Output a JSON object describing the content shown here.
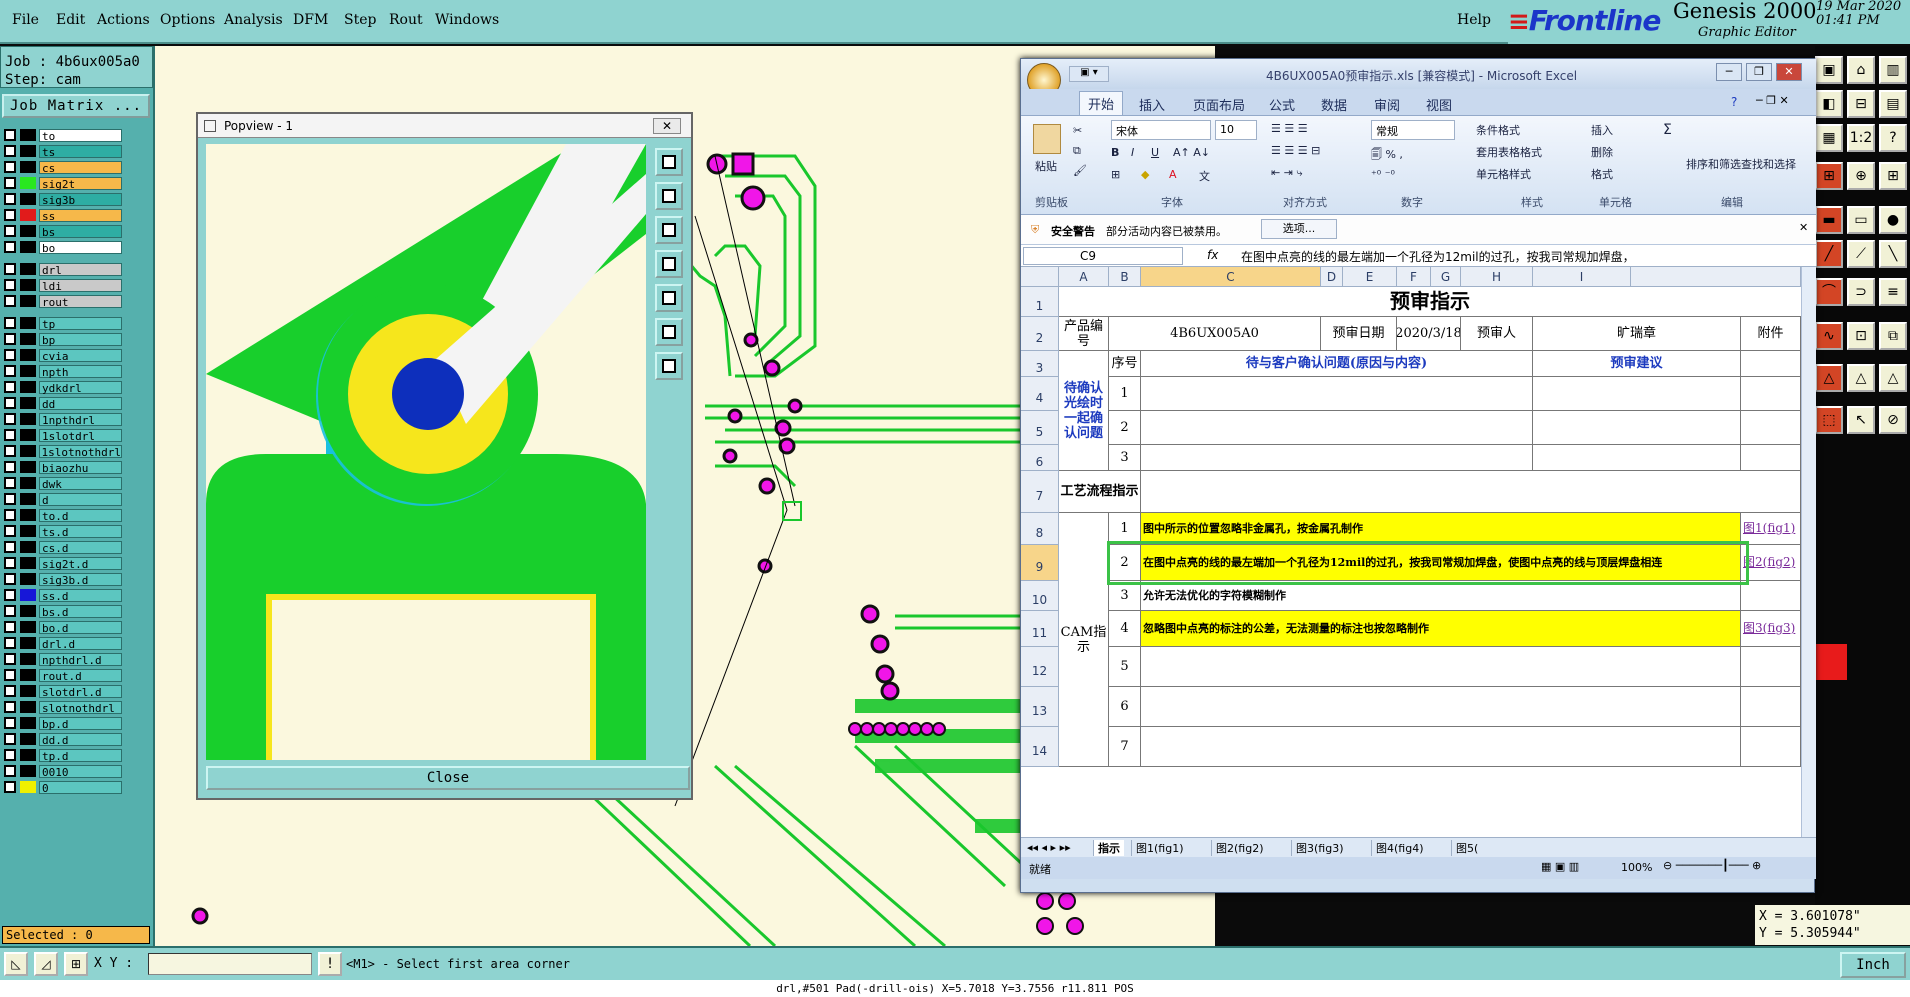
{
  "menubar": {
    "items": [
      "File",
      "Edit",
      "Actions",
      "Options",
      "Analysis",
      "DFM",
      "Step",
      "Rout",
      "Windows"
    ],
    "help": "Help"
  },
  "brand": {
    "logo": "Frontline",
    "product": "Genesis 2000",
    "subtitle": "Graphic Editor",
    "date": "19 Mar 2020",
    "time": "01:41 PM"
  },
  "job": {
    "job_line": "Job : 4b6ux005a0",
    "step_line": "Step: cam",
    "matrix_button": "Job Matrix ..."
  },
  "layers": [
    {
      "name": "to",
      "sw": "#000000",
      "bg": "wh"
    },
    {
      "name": "ts",
      "sw": "#000000",
      "bg": "tl"
    },
    {
      "name": "cs",
      "sw": "#000000",
      "bg": "yl"
    },
    {
      "name": "sig2t",
      "sw": "#29e81f",
      "bg": "yl"
    },
    {
      "name": "sig3b",
      "sw": "#000000",
      "bg": "tl"
    },
    {
      "name": "ss",
      "sw": "#e11b1b",
      "bg": "yl"
    },
    {
      "name": "bs",
      "sw": "#000000",
      "bg": "tl"
    },
    {
      "name": "bo",
      "sw": "#000000",
      "bg": "wh"
    },
    {
      "name": "drl",
      "sw": "#000000",
      "bg": "gy"
    },
    {
      "name": "ldi",
      "sw": "#000000",
      "bg": "gy"
    },
    {
      "name": "rout",
      "sw": "#000000",
      "bg": "gy"
    },
    {
      "name": "tp",
      "sw": "#000000",
      "bg": ""
    },
    {
      "name": "bp",
      "sw": "#000000",
      "bg": ""
    },
    {
      "name": "cvia",
      "sw": "#000000",
      "bg": ""
    },
    {
      "name": "npth",
      "sw": "#000000",
      "bg": ""
    },
    {
      "name": "ydkdrl",
      "sw": "#000000",
      "bg": ""
    },
    {
      "name": "dd",
      "sw": "#000000",
      "bg": ""
    },
    {
      "name": "1npthdrl",
      "sw": "#000000",
      "bg": ""
    },
    {
      "name": "1slotdrl",
      "sw": "#000000",
      "bg": ""
    },
    {
      "name": "1slotnothdrl",
      "sw": "#000000",
      "bg": ""
    },
    {
      "name": "biaozhu",
      "sw": "#000000",
      "bg": ""
    },
    {
      "name": "dwk",
      "sw": "#000000",
      "bg": ""
    },
    {
      "name": "d",
      "sw": "#000000",
      "bg": ""
    },
    {
      "name": "to.d",
      "sw": "#000000",
      "bg": ""
    },
    {
      "name": "ts.d",
      "sw": "#000000",
      "bg": ""
    },
    {
      "name": "cs.d",
      "sw": "#000000",
      "bg": ""
    },
    {
      "name": "sig2t.d",
      "sw": "#000000",
      "bg": ""
    },
    {
      "name": "sig3b.d",
      "sw": "#000000",
      "bg": ""
    },
    {
      "name": "ss.d",
      "sw": "#1717d8",
      "bg": ""
    },
    {
      "name": "bs.d",
      "sw": "#000000",
      "bg": ""
    },
    {
      "name": "bo.d",
      "sw": "#000000",
      "bg": ""
    },
    {
      "name": "drl.d",
      "sw": "#000000",
      "bg": ""
    },
    {
      "name": "npthdrl.d",
      "sw": "#000000",
      "bg": ""
    },
    {
      "name": "rout.d",
      "sw": "#000000",
      "bg": ""
    },
    {
      "name": "slotdrl.d",
      "sw": "#000000",
      "bg": ""
    },
    {
      "name": "slotnothdrl",
      "sw": "#000000",
      "bg": ""
    },
    {
      "name": "bp.d",
      "sw": "#000000",
      "bg": ""
    },
    {
      "name": "dd.d",
      "sw": "#000000",
      "bg": ""
    },
    {
      "name": "tp.d",
      "sw": "#000000",
      "bg": ""
    },
    {
      "name": "0010",
      "sw": "#000000",
      "bg": ""
    },
    {
      "name": "0",
      "sw": "#f0f000",
      "bg": ""
    }
  ],
  "selected": "Selected : 0",
  "popview": {
    "title": "Popview - 1",
    "close": "Close"
  },
  "coords": {
    "x": "X = 3.601078\"",
    "y": "Y = 5.305944\""
  },
  "cmdbar": {
    "xy_label": "X Y :",
    "xy_value": "",
    "prompt": "<M1> - Select first area corner",
    "unit": "Inch"
  },
  "statusbar": "drl,#501 Pad(-drill-ois) X=5.7018 Y=3.7556 r11.811 POS",
  "excel": {
    "title": "4B6UX005A0预审指示.xls  [兼容模式] - Microsoft Excel",
    "tabs": [
      "开始",
      "插入",
      "页面布局",
      "公式",
      "数据",
      "审阅",
      "视图"
    ],
    "ribbon": {
      "paste": "粘贴",
      "clipboard": "剪贴板",
      "font_name": "宋体",
      "font_size": "10",
      "font_group": "字体",
      "align_group": "对齐方式",
      "number_format": "常规",
      "number_group": "数字",
      "cond_format": "条件格式",
      "table_format": "套用表格格式",
      "cell_style": "单元格样式",
      "style_group": "样式",
      "insert": "插入",
      "delete": "删除",
      "format": "格式",
      "cells_group": "单元格",
      "sort": "排序和筛选",
      "find": "查找和选择",
      "edit_group": "编辑"
    },
    "warning": {
      "label": "安全警告",
      "text": "部分活动内容已被禁用。",
      "button": "选项..."
    },
    "name_box": "C9",
    "formula": "在图中点亮的线的最左端加一个孔径为12mil的过孔，按我司常规加焊盘，",
    "columns": [
      "A",
      "B",
      "C",
      "D",
      "E",
      "F",
      "G",
      "H",
      "I"
    ],
    "rows": [
      "1",
      "2",
      "3",
      "4",
      "5",
      "6",
      "7",
      "8",
      "9",
      "10",
      "11",
      "12",
      "13",
      "14"
    ],
    "sheet": {
      "title": "预审指示",
      "product_label": "产品编号",
      "product_value": "4B6UX005A0",
      "date_label": "预审日期",
      "date_value": "2020/3/18",
      "reviewer_label": "预审人",
      "reviewer_value": "旷瑞章",
      "attach_label": "附件",
      "seq_label": "序号",
      "issue_header": "待与客户确认问题(原因与内容)",
      "suggest_header": "预审建议",
      "confirm_label": "待确认光绘时一起确认问题",
      "flow_label": "工艺流程指示",
      "cam_label": "CAM指示",
      "confirm_seq": [
        "1",
        "2",
        "3"
      ],
      "cam_items": [
        {
          "no": "1",
          "text": "图中所示的位置忽略非金属孔，按金属孔制作",
          "link": "图1(fig1)",
          "hl": true
        },
        {
          "no": "2",
          "text": "在图中点亮的线的最左端加一个孔径为12mil的过孔，按我司常规加焊盘，使图中点亮的线与顶层焊盘相连",
          "link": "图2(fig2)",
          "hl": true
        },
        {
          "no": "3",
          "text": "允许无法优化的字符模糊制作",
          "link": "",
          "hl": false
        },
        {
          "no": "4",
          "text": "忽略图中点亮的标注的公差，无法测量的标注也按忽略制作",
          "link": "图3(fig3)",
          "hl": true
        },
        {
          "no": "5",
          "text": "",
          "link": "",
          "hl": false
        },
        {
          "no": "6",
          "text": "",
          "link": "",
          "hl": false
        },
        {
          "no": "7",
          "text": "",
          "link": "",
          "hl": false
        }
      ]
    },
    "sheet_tabs": [
      "指示",
      "图1(fig1)",
      "图2(fig2)",
      "图3(fig3)",
      "图4(fig4)",
      "图5("
    ],
    "status_ready": "就绪",
    "zoom": "100%"
  }
}
